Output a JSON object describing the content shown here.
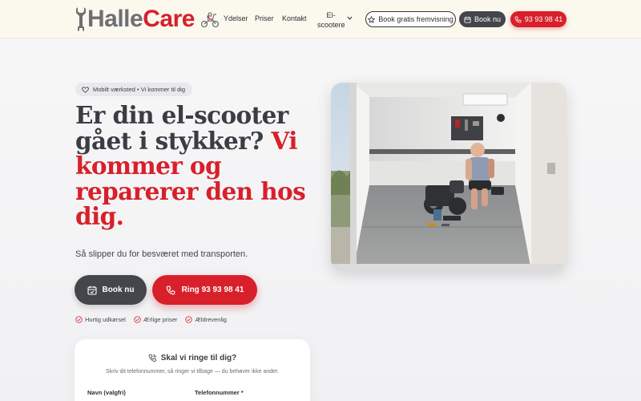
{
  "header": {
    "logo": {
      "part1": "Halle",
      "part2": "Care"
    },
    "nav": [
      {
        "label": "Ydelser"
      },
      {
        "label": "Priser"
      },
      {
        "label": "Kontakt"
      }
    ],
    "dropdown_label": "El-scootere",
    "book_viewing_label": "Book gratis fremvisning",
    "book_label": "Book nu",
    "phone_label": "93 93 98 41"
  },
  "hero": {
    "badge": "Mobilt værksted • Vi kommer til dig",
    "title_part1": "Er din el-scooter gået i stykker?",
    "title_part2": "Vi kommer og reparerer den hos dig.",
    "subtitle": "Så slipper du for besværet med transporten.",
    "book_button": "Book nu",
    "call_button": "Ring 93 93 98 41",
    "features": [
      "Hurtig udkørsel",
      "Ærlige priser",
      "Ældrevenlig"
    ]
  },
  "callback": {
    "title": "Skal vi ringe til dig?",
    "description": "Skriv dit telefonnummer, så ringer vi tilbage — du behøver ikke andet.",
    "name_label": "Navn (valgfri)",
    "phone_label": "Telefonnummer *"
  },
  "colors": {
    "brand_red": "#d8202a",
    "dark": "#44464c",
    "header_bg": "#fbf8ee"
  },
  "icons": [
    "wrench-icon",
    "scooter-icon",
    "star-icon",
    "calendar-icon",
    "phone-icon",
    "heart-icon",
    "check-circle-icon",
    "phone-call-icon",
    "chevron-down-icon"
  ]
}
